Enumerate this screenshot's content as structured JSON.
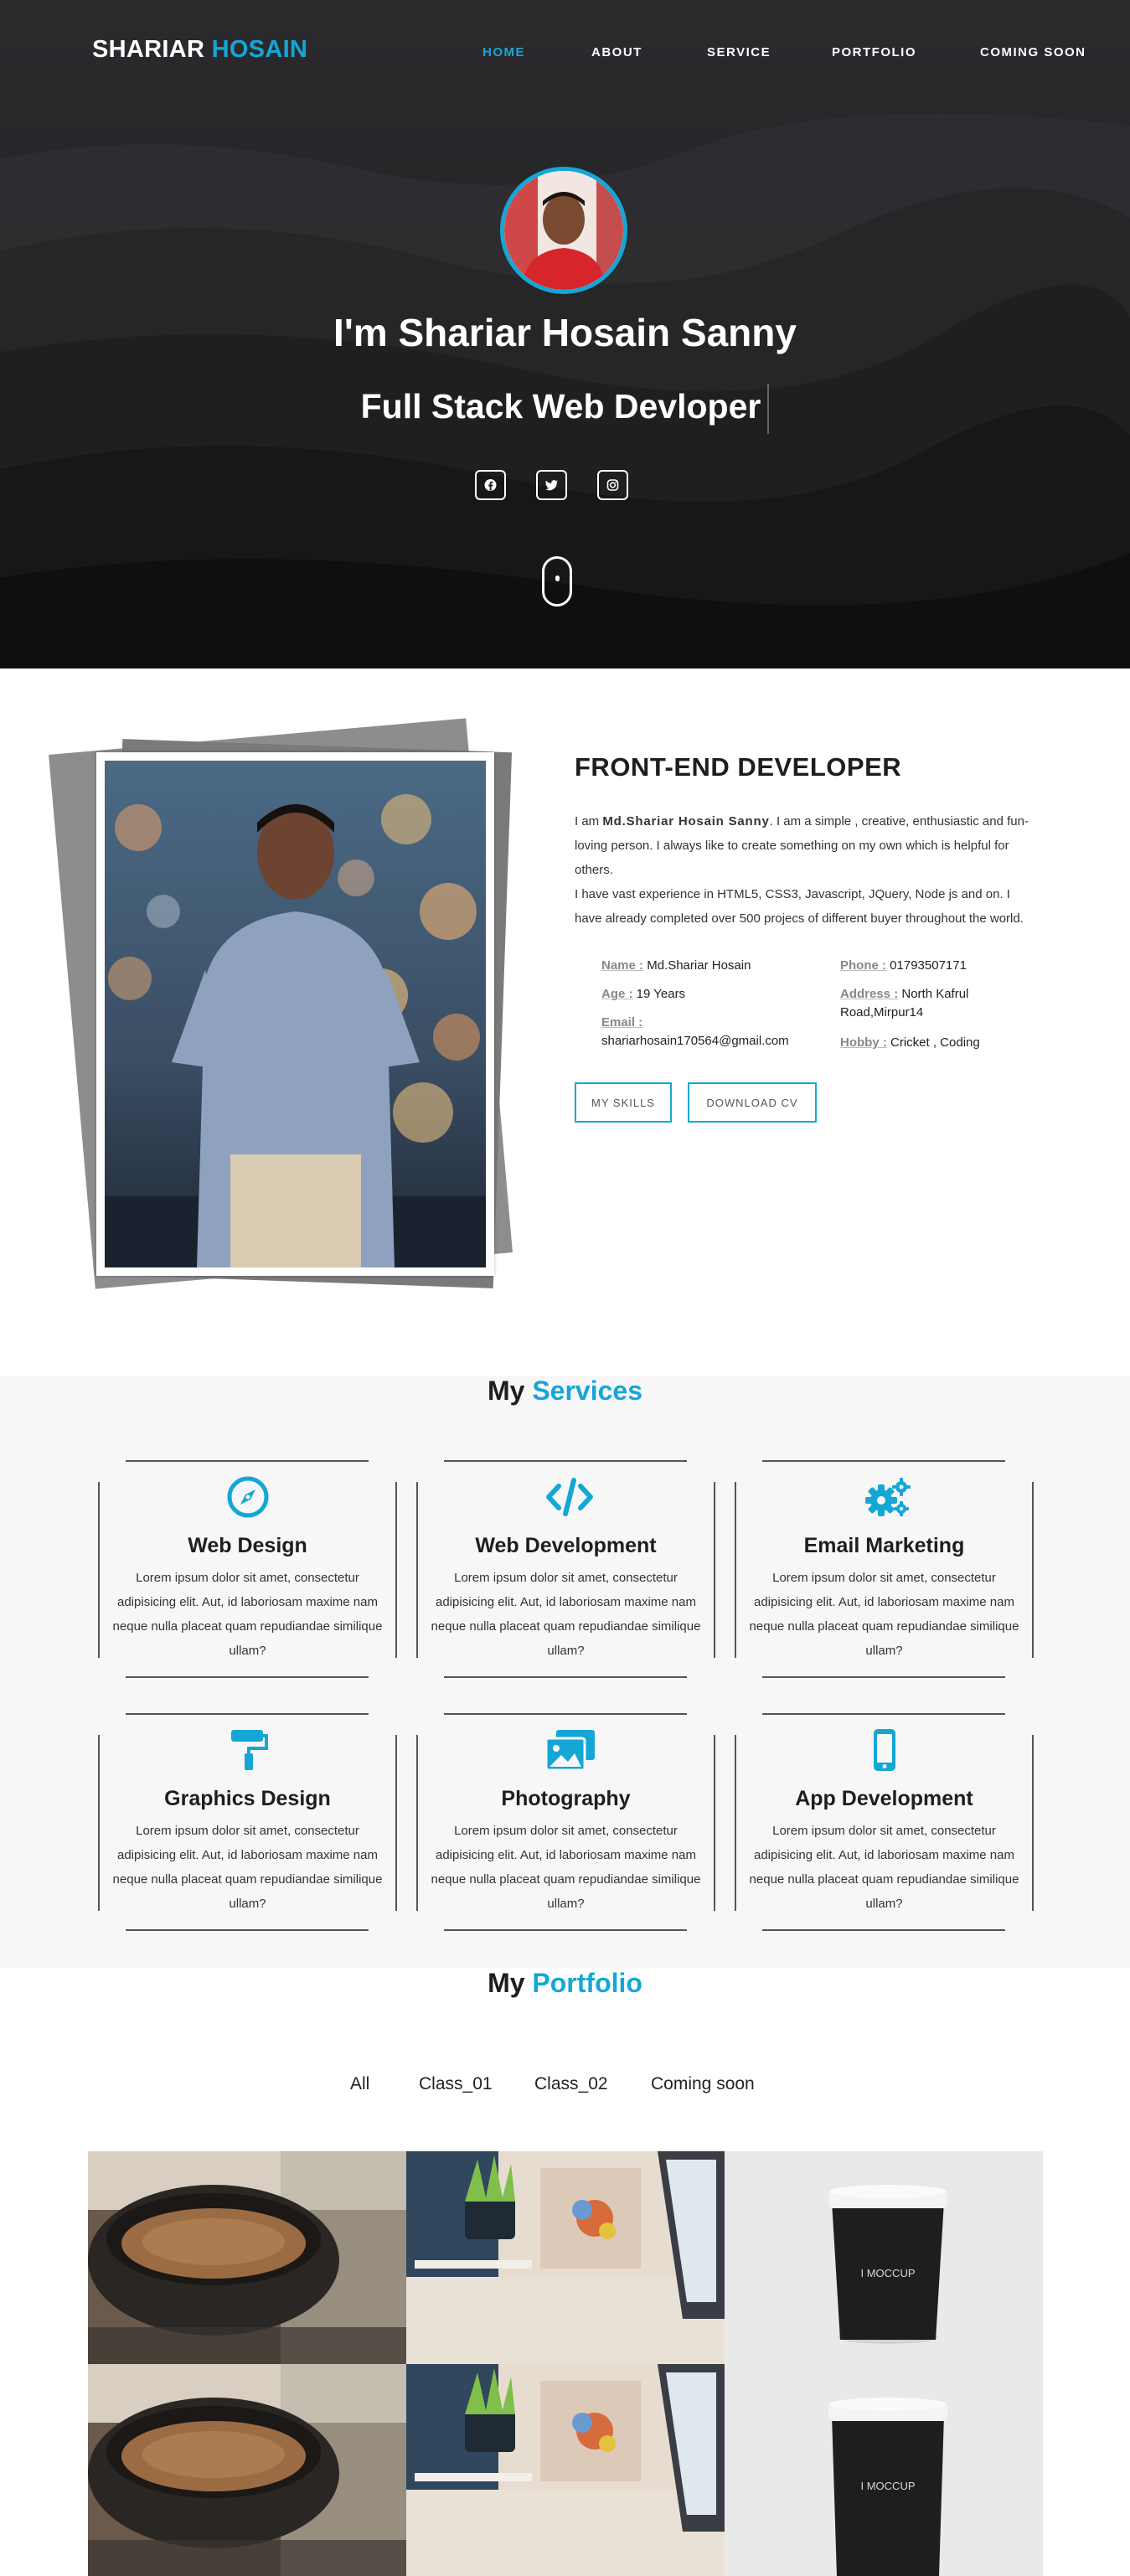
{
  "nav": {
    "brand_first": "SHARIAR",
    "brand_second": "HOSAIN",
    "links": [
      {
        "label": "HOME",
        "active": true
      },
      {
        "label": "ABOUT",
        "active": false
      },
      {
        "label": "SERVICE",
        "active": false
      },
      {
        "label": "PORTFOLIO",
        "active": false
      },
      {
        "label": "COMING SOON",
        "active": false
      }
    ]
  },
  "hero": {
    "name": "I'm Shariar Hosain Sanny",
    "role": "Full Stack Web Devloper",
    "social_icons": [
      "facebook-icon",
      "twitter-icon",
      "instagram-icon"
    ]
  },
  "about": {
    "title": "FRONT-END DEVELOPER",
    "intro_prefix": "I am ",
    "intro_name": "Md.Shariar Hosain Sanny",
    "intro_rest": ". I am a simple , creative, enthusiastic and fun-loving person. I always like to create something on my own which is helpful for others.",
    "experience": "I have vast experience in HTML5, CSS3, Javascript, JQuery, Node js and on. I have already completed over 500 projecs of different buyer throughout the world.",
    "info": {
      "name_label": "Name :",
      "name_value": "Md.Shariar Hosain",
      "phone_label": "Phone :",
      "phone_value": "01793507171",
      "age_label": "Age :",
      "age_value": "19 Years",
      "address_label": "Address :",
      "address_value_1": "North Kafrul",
      "address_value_2": "Road,Mirpur14",
      "email_label": "Email :",
      "email_value": "shariarhosain170564@gmail.com",
      "hobby_label": "Hobby :",
      "hobby_value": "Cricket , Coding"
    },
    "buttons": {
      "skills": "MY SKILLS",
      "cv": "DOWNLOAD CV"
    }
  },
  "services": {
    "title_first": "My",
    "title_second": "Services",
    "items": [
      {
        "title": "Web Design",
        "icon": "compass-icon",
        "text": "Lorem ipsum dolor sit amet, consectetur adipisicing elit. Aut, id laboriosam maxime nam neque nulla placeat quam repudiandae similique ullam?"
      },
      {
        "title": "Web Development",
        "icon": "code-icon",
        "text": "Lorem ipsum dolor sit amet, consectetur adipisicing elit. Aut, id laboriosam maxime nam neque nulla placeat quam repudiandae similique ullam?"
      },
      {
        "title": "Email Marketing",
        "icon": "gears-icon",
        "text": "Lorem ipsum dolor sit amet, consectetur adipisicing elit. Aut, id laboriosam maxime nam neque nulla placeat quam repudiandae similique ullam?"
      },
      {
        "title": "Graphics Design",
        "icon": "paint-roller-icon",
        "text": "Lorem ipsum dolor sit amet, consectetur adipisicing elit. Aut, id laboriosam maxime nam neque nulla placeat quam repudiandae similique ullam?"
      },
      {
        "title": "Photography",
        "icon": "photo-gallery-icon",
        "text": "Lorem ipsum dolor sit amet, consectetur adipisicing elit. Aut, id laboriosam maxime nam neque nulla placeat quam repudiandae similique ullam?"
      },
      {
        "title": "App Development",
        "icon": "mobile-phone-icon",
        "text": "Lorem ipsum dolor sit amet, consectetur adipisicing elit. Aut, id laboriosam maxime nam neque nulla placeat quam repudiandae similique ullam?"
      }
    ]
  },
  "portfolio": {
    "title_first": "My",
    "title_second": "Portfolio",
    "filters": [
      "All",
      "Class_01",
      "Class_02",
      "Coming soon"
    ],
    "cup_text": "I MOCCUP"
  },
  "colors": {
    "accent": "#14a7d6",
    "hero_bg": "#1c1b1d",
    "services_bg": "#f7f7f7"
  }
}
